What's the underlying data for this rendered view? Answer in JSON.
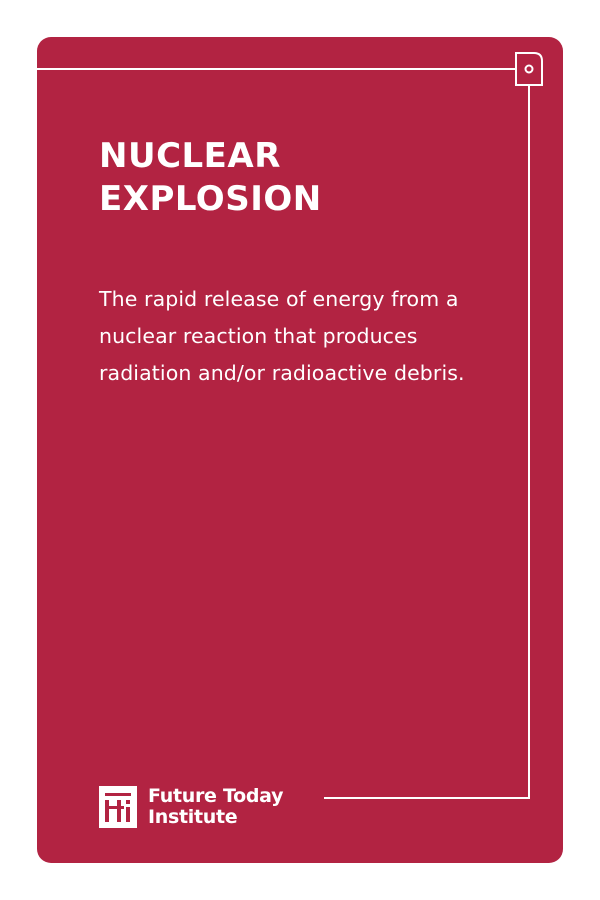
{
  "colors": {
    "card_background": "#b22342",
    "text": "#ffffff",
    "page_background": "#ffffff"
  },
  "card": {
    "title_lines": [
      "NUCLEAR",
      "EXPLOSION"
    ],
    "definition": "The rapid release of energy from a nuclear reaction that produces radiation and/or radioactive debris."
  },
  "brand": {
    "logo_icon": "future-today-institute-logo-icon",
    "name_lines": [
      "Future Today",
      "Institute"
    ]
  }
}
